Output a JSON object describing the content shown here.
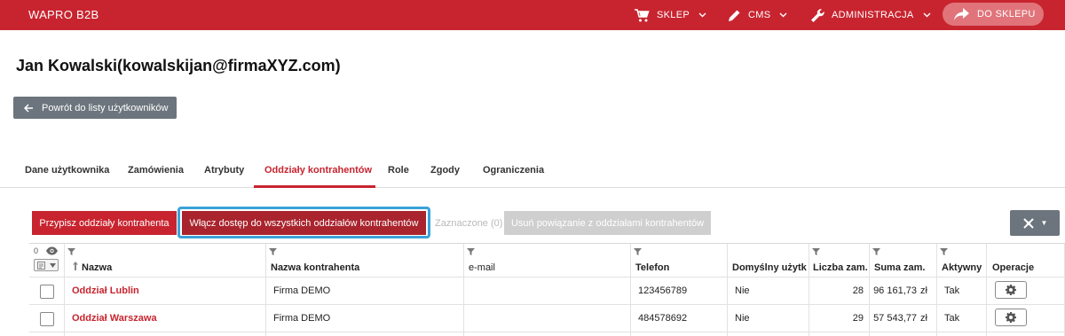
{
  "topbar": {
    "brand": "WAPRO B2B",
    "nav": [
      {
        "label": "SKLEP",
        "icon": "cart-icon"
      },
      {
        "label": "CMS",
        "icon": "pencil-icon"
      },
      {
        "label": "ADMINISTRACJA",
        "icon": "wrench-icon"
      }
    ],
    "to_shop": "DO SKLEPU"
  },
  "page_title": "Jan Kowalski(kowalskijan@firmaXYZ.com)",
  "back_button": "Powrót do listy użytkowników",
  "tabs": [
    {
      "label": "Dane użytkownika",
      "active": false
    },
    {
      "label": "Zamówienia",
      "active": false
    },
    {
      "label": "Atrybuty",
      "active": false
    },
    {
      "label": "Oddziały kontrahentów",
      "active": true
    },
    {
      "label": "Role",
      "active": false
    },
    {
      "label": "Zgody",
      "active": false
    },
    {
      "label": "Ograniczenia",
      "active": false
    }
  ],
  "actions": {
    "assign": "Przypisz oddziały kontrahenta",
    "enable_all": "Włącz dostęp do wszystkich oddziałów kontrahentów",
    "selected": "Zaznaczone (0)",
    "remove": "Usuń powiązanie z oddziałami kontrahentów"
  },
  "grid": {
    "hidden_count": "0",
    "columns": [
      "Nazwa",
      "Nazwa kontrahenta",
      "e-mail",
      "Telefon",
      "Domyślny użytkow",
      "Liczba zam.",
      "Suma zam.",
      "Aktywny",
      "Operacje"
    ],
    "rows": [
      {
        "name": "Oddział Lublin",
        "contractor": "Firma DEMO",
        "email": "",
        "phone": "123456789",
        "default_user": "Nie",
        "orders": "28",
        "sum": "96 161,73",
        "currency": "zł",
        "active": "Tak"
      },
      {
        "name": "Oddział Warszawa",
        "contractor": "Firma DEMO",
        "email": "",
        "phone": "484578692",
        "default_user": "Nie",
        "orders": "29",
        "sum": "57 543,77",
        "currency": "zł",
        "active": "Tak"
      }
    ]
  },
  "colors": {
    "brand_red": "#c8242f",
    "highlight_blue": "#3aa3d7",
    "secondary_gray": "#6c757d"
  }
}
